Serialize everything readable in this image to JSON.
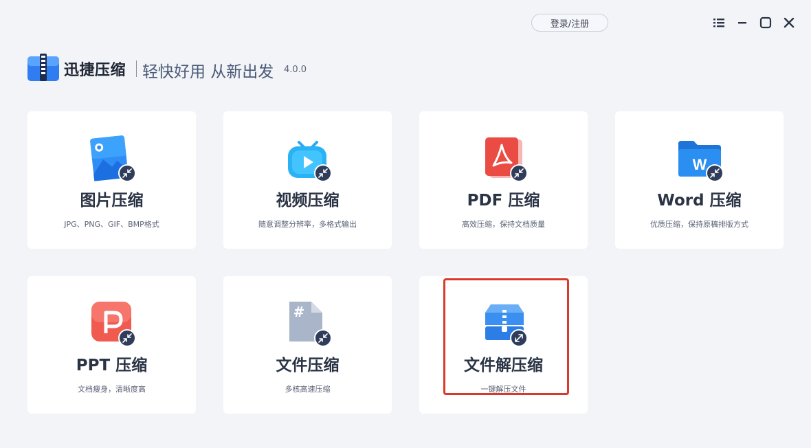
{
  "header": {
    "login_label": "登录/注册",
    "brand_name": "迅捷压缩",
    "slogan": "轻快好用 从新出发",
    "version": "4.0.0"
  },
  "window_controls": {
    "icons": [
      "list-icon",
      "minimize-icon",
      "maximize-icon",
      "close-icon"
    ]
  },
  "cards": [
    {
      "title": "图片压缩",
      "desc": "JPG、PNG、GIF、BMP格式",
      "icon": "image-icon"
    },
    {
      "title": "视频压缩",
      "desc": "随意调整分辨率，多格式输出",
      "icon": "video-tv-icon"
    },
    {
      "title": "PDF 压缩",
      "desc": "高效压缩，保持文档质量",
      "icon": "pdf-icon"
    },
    {
      "title": "Word 压缩",
      "desc": "优质压缩，保持原稿排版方式",
      "icon": "word-folder-icon"
    },
    {
      "title": "PPT 压缩",
      "desc": "文档瘦身，清晰度高",
      "icon": "ppt-icon"
    },
    {
      "title": "文件压缩",
      "desc": "多核高速压缩",
      "icon": "file-hash-icon"
    },
    {
      "title": "文件解压缩",
      "desc": "一键解压文件",
      "icon": "unzip-icon"
    }
  ],
  "colors": {
    "background": "#f3f4f7",
    "card": "#ffffff",
    "highlight": "#d9382a",
    "badge": "#2f3c5a"
  }
}
